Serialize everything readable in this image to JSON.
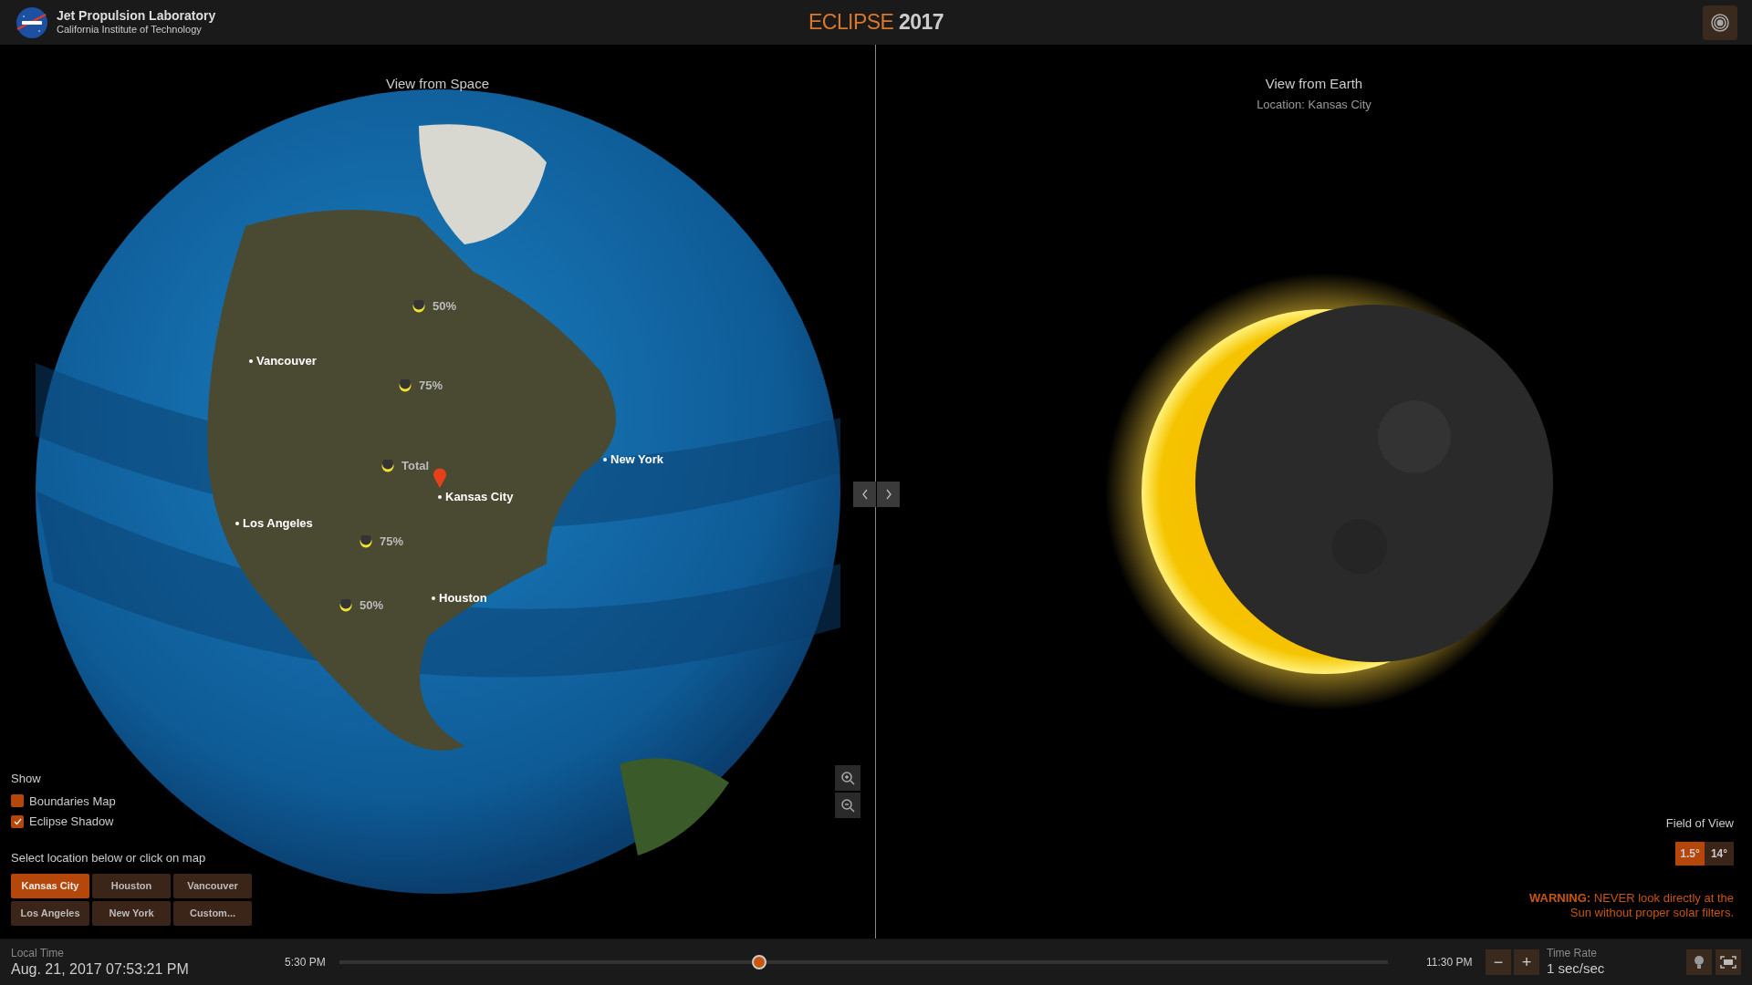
{
  "header": {
    "org_name": "Jet Propulsion Laboratory",
    "org_subtitle": "California Institute of Technology",
    "title_light": "ECLIPSE",
    "title_bold": "2017"
  },
  "space_view": {
    "title": "View from Space",
    "markers": [
      {
        "kind": "shadow",
        "label": "50%"
      },
      {
        "kind": "city",
        "label": "Vancouver"
      },
      {
        "kind": "shadow",
        "label": "75%"
      },
      {
        "kind": "shadow",
        "label": "Total"
      },
      {
        "kind": "city",
        "label": "New York"
      },
      {
        "kind": "pin",
        "label": "Kansas City"
      },
      {
        "kind": "city",
        "label": "Los Angeles"
      },
      {
        "kind": "shadow",
        "label": "75%"
      },
      {
        "kind": "shadow",
        "label": "50%"
      },
      {
        "kind": "city",
        "label": "Houston"
      }
    ]
  },
  "show": {
    "title": "Show",
    "options": [
      {
        "label": "Boundaries Map",
        "checked": false
      },
      {
        "label": "Eclipse Shadow",
        "checked": true
      }
    ]
  },
  "location_prompt": "Select location below or click on map",
  "locations": [
    {
      "label": "Kansas City",
      "selected": true
    },
    {
      "label": "Houston",
      "selected": false
    },
    {
      "label": "Vancouver",
      "selected": false
    },
    {
      "label": "Los Angeles",
      "selected": false
    },
    {
      "label": "New York",
      "selected": false
    },
    {
      "label": "Custom...",
      "selected": false
    }
  ],
  "earth_view": {
    "title": "View from Earth",
    "location": "Location: Kansas City"
  },
  "field_of_view": {
    "title": "Field of View",
    "options": [
      {
        "label": "1.5°",
        "selected": true
      },
      {
        "label": "14°",
        "selected": false
      }
    ]
  },
  "warning": "**WARNING:** NEVER look directly at the Sun without proper solar filters.",
  "status_bar": {
    "local_time_label": "Local Time",
    "local_time": "Aug. 21, 2017 07:53:21 PM",
    "start_time": "5:30 PM",
    "end_time": "11:30 PM",
    "time": {
      "level": 0.4
    },
    "minus": "−",
    "plus": "+",
    "time_rate_label": "Time Rate",
    "time_rate": "1 sec/sec"
  }
}
